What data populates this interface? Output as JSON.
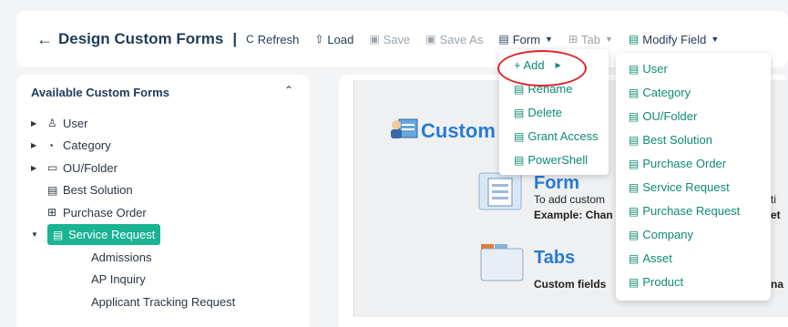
{
  "toolbar": {
    "back_arrow": "←",
    "title": "Design Custom Forms",
    "separator": "|",
    "refresh": "Refresh",
    "load": "Load",
    "save": "Save",
    "save_as": "Save As",
    "form": "Form",
    "tab": "Tab",
    "modify_field": "Modify Field"
  },
  "sidebar": {
    "title": "Available Custom Forms",
    "items": [
      {
        "label": "User",
        "icon": "user-icon",
        "expandable": true
      },
      {
        "label": "Category",
        "icon": "category-icon",
        "expandable": true
      },
      {
        "label": "OU/Folder",
        "icon": "folder-icon",
        "expandable": true
      },
      {
        "label": "Best Solution",
        "icon": "document-icon",
        "expandable": false
      },
      {
        "label": "Purchase Order",
        "icon": "purchase-icon",
        "expandable": false
      },
      {
        "label": "Service Request",
        "icon": "document-icon",
        "expandable": true,
        "selected": true
      }
    ],
    "children": [
      "Admissions",
      "AP Inquiry",
      "Applicant Tracking Request"
    ]
  },
  "form_menu": {
    "add": "+ Add",
    "items": [
      "Rename",
      "Delete",
      "Grant Access",
      "PowerShell"
    ]
  },
  "add_submenu": {
    "items": [
      "User",
      "Category",
      "OU/Folder",
      "Best Solution",
      "Purchase Order",
      "Service Request",
      "Purchase Request",
      "Company",
      "Asset",
      "Product"
    ]
  },
  "content": {
    "custom_title": "Custom I",
    "form_heading": "Form",
    "form_desc_1": "To add custom",
    "form_desc_2": "Example: Chan",
    "form_frag_1": "ti",
    "form_frag_2": "et",
    "tabs_heading": "Tabs",
    "tabs_desc": "Custom fields",
    "tabs_frag": "na"
  },
  "colors": {
    "accent": "#1ab394",
    "menu_text": "#0f8a72",
    "heading_blue": "#2a7bd1",
    "highlight_ring": "#e0242b"
  }
}
